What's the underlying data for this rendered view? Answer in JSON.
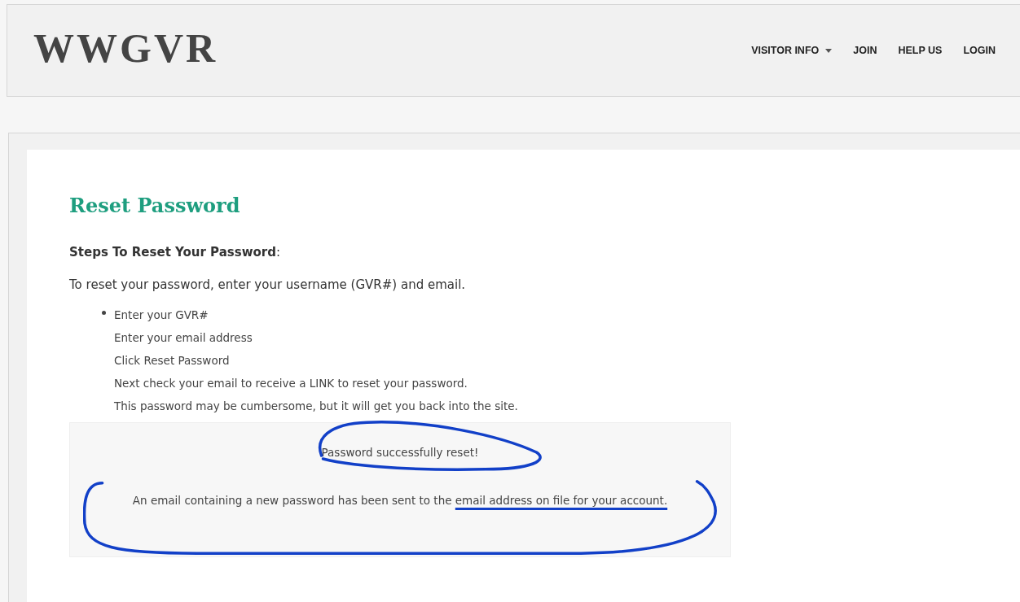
{
  "header": {
    "logo": "WWGVR",
    "nav": [
      {
        "label": "VISITOR INFO",
        "dropdown": true
      },
      {
        "label": "JOIN",
        "dropdown": false
      },
      {
        "label": "HELP US",
        "dropdown": false
      },
      {
        "label": "LOGIN",
        "dropdown": false
      }
    ]
  },
  "page": {
    "title": "Reset Password",
    "steps_heading": "**Steps To Reset Your Password**:",
    "intro": "To reset your password, enter your username (GVR#) and email.",
    "steps": [
      "Enter your GVR#",
      "Enter your email address",
      "Click Reset Password",
      "Next check your email to receive a LINK to reset your password.",
      "This password may be cumbersome, but it will get you back into the site."
    ]
  },
  "message": {
    "success": "Password successfully reset!",
    "text": "An email containing a new password has been sent to the",
    "link": "email address on file for your account."
  }
}
